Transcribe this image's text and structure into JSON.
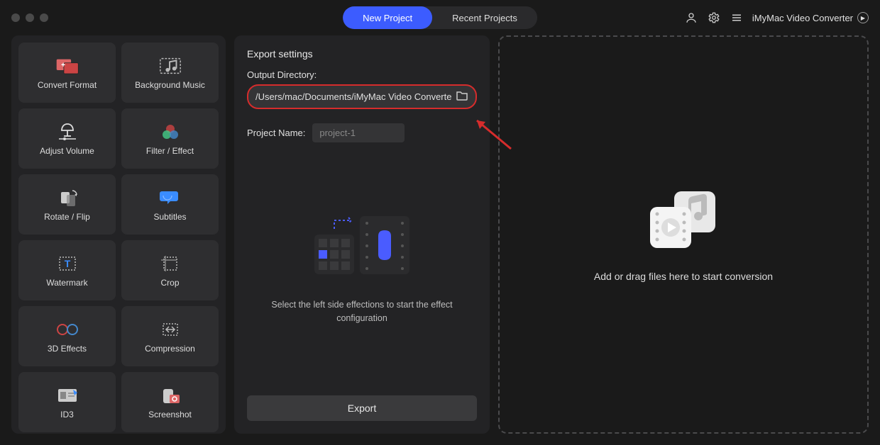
{
  "titlebar": {
    "tabs": {
      "new_project": "New Project",
      "recent_projects": "Recent Projects"
    },
    "app_name": "iMyMac Video Converter"
  },
  "sidebar": {
    "tools": [
      {
        "id": "convert-format",
        "label": "Convert Format"
      },
      {
        "id": "background-music",
        "label": "Background Music"
      },
      {
        "id": "adjust-volume",
        "label": "Adjust Volume"
      },
      {
        "id": "filter-effect",
        "label": "Filter / Effect"
      },
      {
        "id": "rotate-flip",
        "label": "Rotate / Flip"
      },
      {
        "id": "subtitles",
        "label": "Subtitles"
      },
      {
        "id": "watermark",
        "label": "Watermark"
      },
      {
        "id": "crop",
        "label": "Crop"
      },
      {
        "id": "3d-effects",
        "label": "3D Effects"
      },
      {
        "id": "compression",
        "label": "Compression"
      },
      {
        "id": "id3",
        "label": "ID3"
      },
      {
        "id": "screenshot",
        "label": "Screenshot"
      }
    ]
  },
  "center": {
    "section_title": "Export settings",
    "output_dir_label": "Output Directory:",
    "output_dir_value": "/Users/mac/Documents/iMyMac Video Converte",
    "project_name_label": "Project Name:",
    "project_name_placeholder": "project-1",
    "hint_text": "Select the left side effections to start the effect configuration",
    "export_label": "Export"
  },
  "dropzone": {
    "hint": "Add or drag files here to start conversion"
  }
}
